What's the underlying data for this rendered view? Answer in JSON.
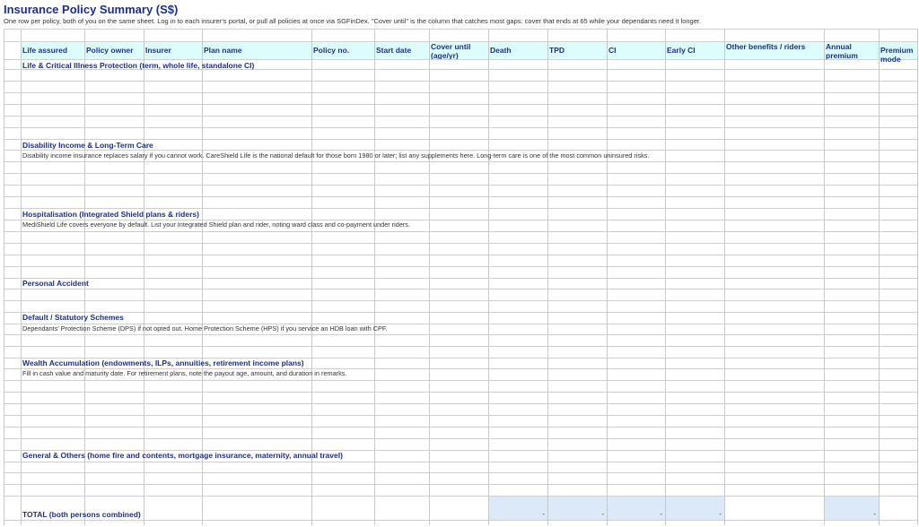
{
  "sheet": {
    "title": "Insurance Policy Summary (S$)",
    "subtitle": "One row per policy, both of you on the same sheet. Log in to each insurer's portal, or pull all policies at once via SGFinDex. \"Cover until\" is the column that catches most gaps: cover that ends at 65 while your dependants need it longer.",
    "columns": [
      "Life assured",
      "Policy owner",
      "Insurer",
      "Plan name",
      "Policy no.",
      "Start date",
      "Cover until (age/yr)",
      "Death",
      "TPD",
      "CI",
      "Early CI",
      "Other benefits / riders",
      "Annual premium",
      "Premium mode"
    ],
    "sections": [
      {
        "name": "Life & Critical Illness Protection (term, whole life, standalone CI)",
        "note": ""
      },
      {
        "name": "Disability Income & Long-Term Care",
        "note": "Disability income insurance replaces salary if you cannot work. CareShield Life is the national default for those born 1980 or later; list any supplements here. Long-term care is one of the most common uninsured risks."
      },
      {
        "name": "Hospitalisation (Integrated Shield plans & riders)",
        "note": "MediShield Life covers everyone by default. List your Integrated Shield plan and rider, noting ward class and co-payment under riders."
      },
      {
        "name": "Personal Accident",
        "note": ""
      },
      {
        "name": "Default / Statutory Schemes",
        "note": "Dependants' Protection Scheme (DPS) if not opted out. Home Protection Scheme (HPS) if you service an HDB loan with CPF."
      },
      {
        "name": "Wealth Accumulation (endowments, ILPs, annuities, retirement income plans)",
        "note": "Fill in cash value and maturity date. For retirement plans, note the payout age, amount, and duration in remarks."
      },
      {
        "name": "General & Others (home fire and contents, mortgage insurance, maternity, annual travel)",
        "note": ""
      }
    ],
    "total": {
      "label": "TOTAL (both persons combined)",
      "death": "-",
      "tpd": "-",
      "ci": "-",
      "early_ci": "-",
      "annual_premium": "-"
    }
  }
}
